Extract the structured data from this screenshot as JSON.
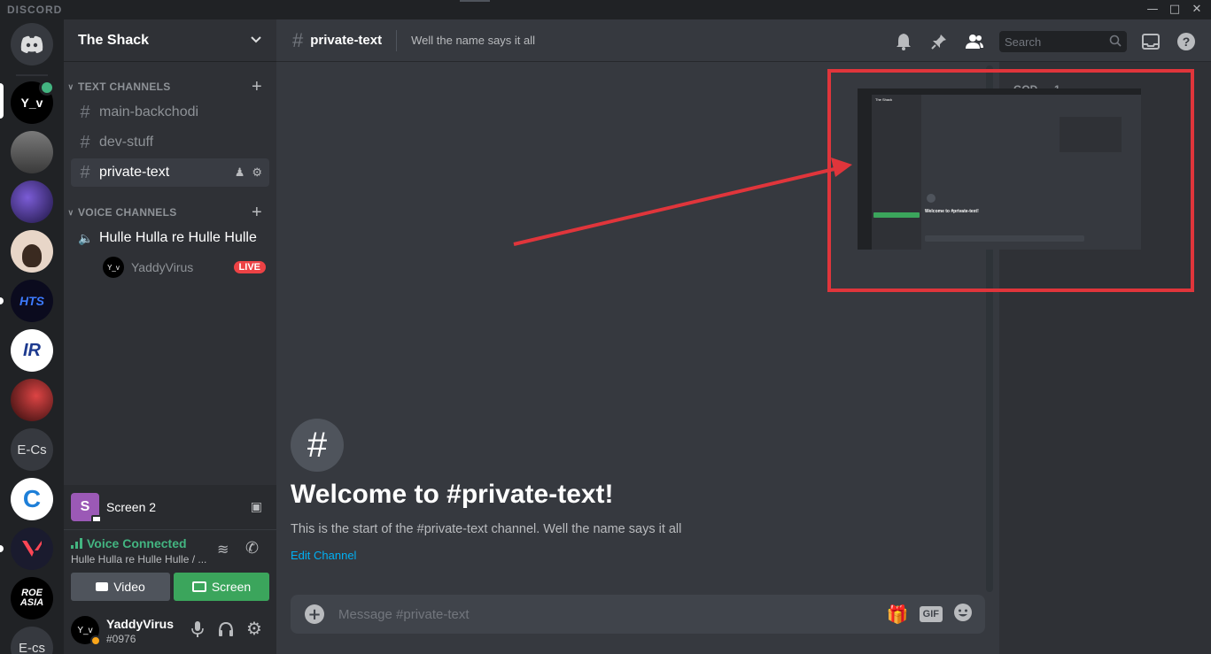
{
  "app": {
    "brand": "DISCORD",
    "window_controls": [
      "minimize",
      "maximize",
      "close"
    ]
  },
  "rail": {
    "servers": [
      {
        "label": "",
        "icon": "discord-home-icon",
        "color": "#36393f"
      },
      {
        "label": "Y_v",
        "color": "#000000"
      },
      {
        "label": "",
        "color": "#5a5a5a"
      },
      {
        "label": "",
        "color": "#3a2d7a"
      },
      {
        "label": "",
        "color": "#e8d6c8"
      },
      {
        "label": "HTS",
        "color": "#0b0b1e"
      },
      {
        "label": "IR",
        "color": "#ffffff"
      },
      {
        "label": "",
        "color": "#5b1515"
      },
      {
        "label": "E-Cs",
        "color": "#36393f"
      },
      {
        "label": "C",
        "color": "#ffffff"
      },
      {
        "label": "",
        "color": "#1a1b2e"
      },
      {
        "label": "ROE ASIA",
        "color": "#000000"
      },
      {
        "label": "E-cs",
        "color": "#36393f"
      }
    ]
  },
  "guild": {
    "name": "The Shack"
  },
  "sidebar": {
    "text_category": "TEXT CHANNELS",
    "text_channels": [
      "main-backchodi",
      "dev-stuff",
      "private-text"
    ],
    "voice_category": "VOICE CHANNELS",
    "voice_channel": "Hulle Hulla re Hulle Hulle",
    "voice_user": "YaddyVirus",
    "live_badge": "LIVE"
  },
  "panel": {
    "screen_label": "Screen 2",
    "screen_avatar": "S",
    "voice_status": "Voice Connected",
    "voice_location": "Hulle Hulla re Hulle Hulle / ...",
    "video_label": "Video",
    "screen_button_label": "Screen",
    "username": "YaddyVirus",
    "discriminator": "#0976",
    "user_avatar": "Y_v"
  },
  "header": {
    "channel_name": "private-text",
    "topic": "Well the name says it all",
    "search_placeholder": "Search"
  },
  "welcome": {
    "title": "Welcome to #private-text!",
    "subtitle": "This is the start of the #private-text channel. Well the name says it all",
    "edit_link": "Edit Channel"
  },
  "composer": {
    "placeholder": "Message #private-text",
    "gif_label": "GIF"
  },
  "members": {
    "partial_heading": "GOD — 1"
  },
  "thumbnail": {
    "guild_name": "The Shack",
    "welcome_title": "Welcome to #private-text!"
  },
  "colors": {
    "accent": "#7289da",
    "green": "#43b581",
    "live_red": "#ed4245",
    "annotation_red": "#e0353b",
    "link_blue": "#00b0f4"
  }
}
